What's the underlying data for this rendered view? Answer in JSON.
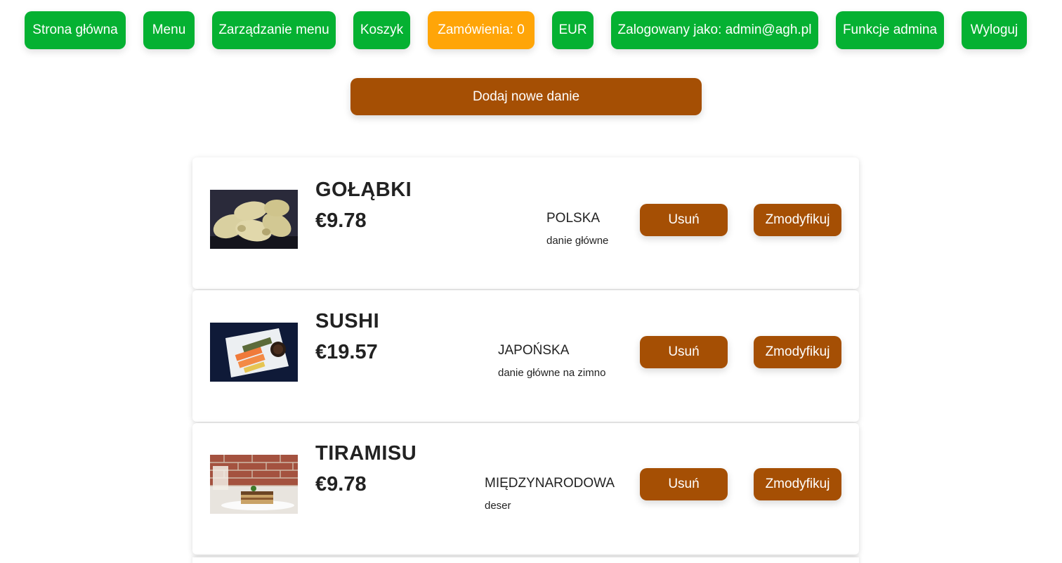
{
  "nav": {
    "home": "Strona główna",
    "menu": "Menu",
    "menu_management": "Zarządzanie menu",
    "cart": "Koszyk",
    "orders": "Zamówienia: 0",
    "currency": "EUR",
    "logged_in": "Zalogowany jako: admin@agh.pl",
    "admin_functions": "Funkcje admina",
    "logout": "Wyloguj"
  },
  "add_dish_label": "Dodaj nowe danie",
  "dishes": [
    {
      "name": "GOŁĄBKI",
      "price": "€9.78",
      "cuisine": "POLSKA",
      "category": "danie główne",
      "delete_label": "Usuń",
      "modify_label": "Zmodyfikuj",
      "image": "golabki-photo"
    },
    {
      "name": "SUSHI",
      "price": "€19.57",
      "cuisine": "JAPOŃSKA",
      "category": "danie główne na zimno",
      "delete_label": "Usuń",
      "modify_label": "Zmodyfikuj",
      "image": "sushi-photo"
    },
    {
      "name": "TIRAMISU",
      "price": "€9.78",
      "cuisine": "MIĘDZYNARODOWA",
      "category": "deser",
      "delete_label": "Usuń",
      "modify_label": "Zmodyfikuj",
      "image": "tiramisu-photo"
    }
  ],
  "colors": {
    "nav_green": "#05b132",
    "orders_orange": "#ffa508",
    "action_brown": "#a54f04"
  }
}
